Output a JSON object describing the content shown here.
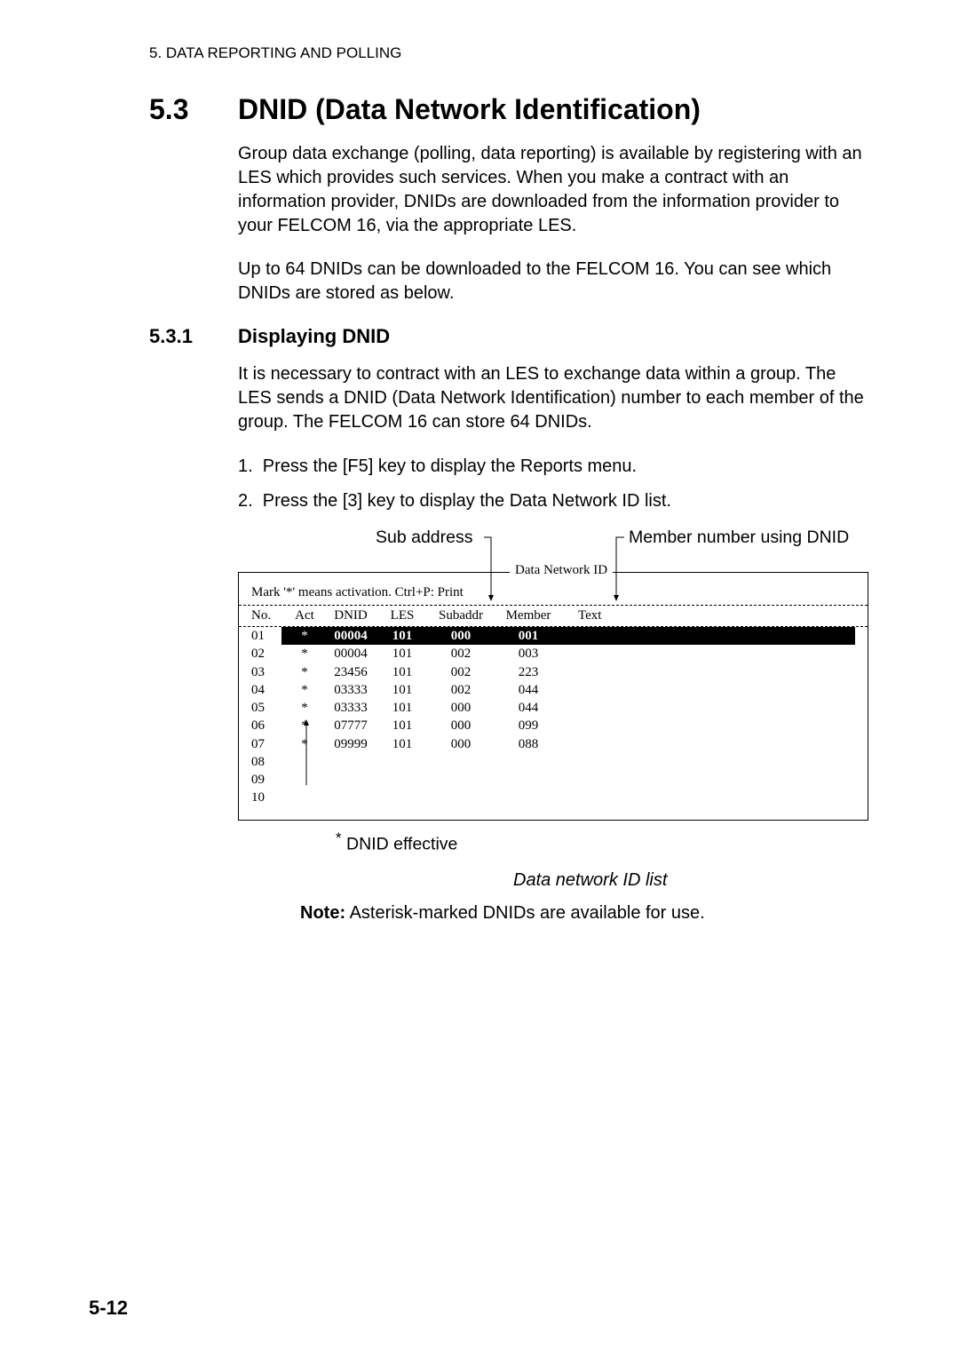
{
  "header_line": "5. DATA REPORTING AND POLLING",
  "section": {
    "number": "5.3",
    "heading": "DNID (Data Network Identification)"
  },
  "para1": "Group data exchange (polling, data reporting) is available by registering with an LES which provides such services. When you make a contract with an information provider, DNIDs are downloaded from the information provider to your FELCOM 16, via the appropriate LES.",
  "para2": "Up to 64 DNIDs can be downloaded to the FELCOM 16. You can see which DNIDs are stored as below.",
  "subsection": {
    "number": "5.3.1",
    "heading": "Displaying DNID"
  },
  "para3": "It is necessary to contract with an LES to exchange data within a group. The LES sends a DNID (Data Network Identification) number to each member of the group. The FELCOM 16 can store 64 DNIDs.",
  "steps": {
    "s1": "1.  Press the [F5] key to display the Reports menu.",
    "s2": "2.  Press the [3] key to display the Data Network ID list."
  },
  "annotations": {
    "subaddress": "Sub address",
    "member_number": "Member number using DNID"
  },
  "box": {
    "title": "Data Network ID",
    "activation_note": "Mark '*' means activation. Ctrl+P: Print",
    "headers": {
      "no": "No.",
      "act": "Act",
      "dnid": "DNID",
      "les": "LES",
      "subaddr": "Subaddr",
      "member": "Member",
      "text": "Text"
    },
    "rows": [
      {
        "no": "01",
        "act": "*",
        "dnid": "00004",
        "les": "101",
        "subaddr": "000",
        "member": "001",
        "highlight": true
      },
      {
        "no": "02",
        "act": "*",
        "dnid": "00004",
        "les": "101",
        "subaddr": "002",
        "member": "003"
      },
      {
        "no": "03",
        "act": "*",
        "dnid": "23456",
        "les": "101",
        "subaddr": "002",
        "member": "223"
      },
      {
        "no": "04",
        "act": "*",
        "dnid": "03333",
        "les": "101",
        "subaddr": "002",
        "member": "044"
      },
      {
        "no": "05",
        "act": "*",
        "dnid": "03333",
        "les": "101",
        "subaddr": "000",
        "member": "044"
      },
      {
        "no": "06",
        "act": "*",
        "dnid": "07777",
        "les": "101",
        "subaddr": "000",
        "member": "099"
      },
      {
        "no": "07",
        "act": "*",
        "dnid": "09999",
        "les": "101",
        "subaddr": "000",
        "member": "088"
      },
      {
        "no": "08",
        "act": "",
        "dnid": "",
        "les": "",
        "subaddr": "",
        "member": ""
      },
      {
        "no": "09",
        "act": "",
        "dnid": "",
        "les": "",
        "subaddr": "",
        "member": ""
      },
      {
        "no": "10",
        "act": "",
        "dnid": "",
        "les": "",
        "subaddr": "",
        "member": ""
      }
    ]
  },
  "dnid_effective": "DNID effective",
  "caption": "Data network ID list",
  "note": {
    "label": "Note:",
    "text": " Asterisk-marked DNIDs are available for use."
  },
  "page_number": "5-12"
}
